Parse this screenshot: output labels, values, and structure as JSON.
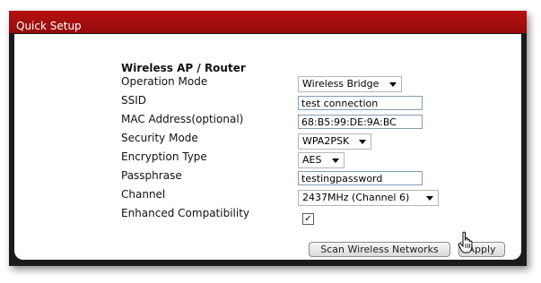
{
  "window": {
    "title": "Quick Setup"
  },
  "section": {
    "title": "Wireless AP / Router"
  },
  "fields": {
    "operation_mode": {
      "label": "Operation Mode",
      "value": "Wireless Bridge"
    },
    "ssid": {
      "label": "SSID",
      "value": "test connection"
    },
    "mac_address": {
      "label": "MAC Address(optional)",
      "value": "68:B5:99:DE:9A:BC"
    },
    "security_mode": {
      "label": "Security Mode",
      "value": "WPA2PSK"
    },
    "encryption_type": {
      "label": "Encryption Type",
      "value": "AES"
    },
    "passphrase": {
      "label": "Passphrase",
      "value": "testingpassword"
    },
    "channel": {
      "label": "Channel",
      "value": "2437MHz (Channel 6)"
    },
    "enhanced_compatibility": {
      "label": "Enhanced Compatibility",
      "checked": true,
      "check_glyph": "✓"
    }
  },
  "buttons": {
    "scan": "Scan Wireless Networks",
    "apply": "Apply"
  },
  "colors": {
    "titlebar": "#a80f0f",
    "frame": "#1b1b1b"
  },
  "icons": {
    "dropdown": "chevron-down-icon",
    "cursor": "hand-pointer-icon"
  }
}
